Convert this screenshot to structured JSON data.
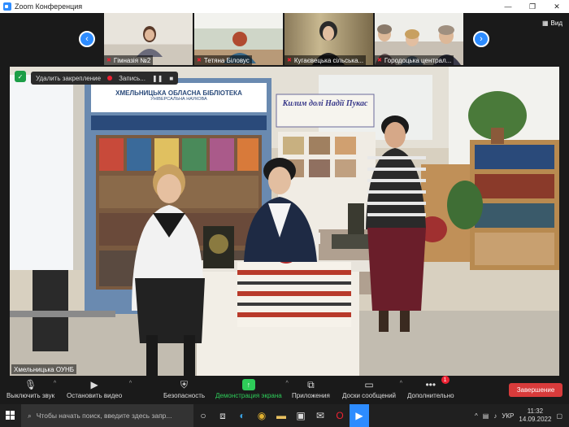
{
  "window": {
    "title": "Zoom Конференция"
  },
  "gallery": {
    "view_label": "Вид",
    "participants": [
      {
        "name": "Гімназія №2"
      },
      {
        "name": "Тетяна Біловус"
      },
      {
        "name": "Кугаєвецька сільська..."
      },
      {
        "name": "Городоцька централ..."
      }
    ]
  },
  "main": {
    "share_stop_label": "Удалить закрепление",
    "record_label": "Запись...",
    "speaker_name": "Хмельницька ОУНБ",
    "banner_text": "ХМЕЛЬНИЦЬКА ОБЛАСНА БІБЛІОТЕКА",
    "banner_sub": "УНІВЕРСАЛЬНА НАУКОВА",
    "sign_text": "Килим долі Надії Пукас"
  },
  "toolbar": {
    "mute_label": "Выключить звук",
    "video_label": "Остановить видео",
    "security_label": "Безопасность",
    "share_label": "Демонстрация экрана",
    "apps_label": "Приложения",
    "whiteboard_label": "Доски сообщений",
    "more_label": "Дополнительно",
    "more_badge": "1",
    "end_label": "Завершение"
  },
  "taskbar": {
    "search_placeholder": "Чтобы начать поиск, введите здесь запр...",
    "lang": "УКР",
    "time": "11:32",
    "date": "14.09.2022"
  },
  "colors": {
    "zoom_blue": "#2d8cff",
    "end_red": "#d83b3b",
    "share_green": "#2ecc59"
  }
}
